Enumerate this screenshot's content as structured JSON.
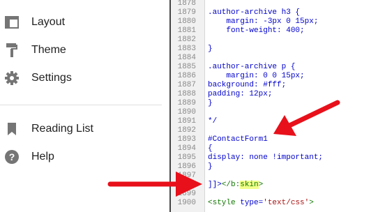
{
  "sidebar": {
    "items": [
      {
        "label": "Layout",
        "icon": "layout-icon"
      },
      {
        "label": "Theme",
        "icon": "paint-roller-icon"
      },
      {
        "label": "Settings",
        "icon": "gear-icon"
      },
      {
        "label": "Reading List",
        "icon": "bookmark-icon"
      },
      {
        "label": "Help",
        "icon": "help-icon"
      }
    ]
  },
  "editor": {
    "lines": [
      {
        "n": "1878",
        "t": ""
      },
      {
        "n": "1879",
        "t": ".author-archive h3 {"
      },
      {
        "n": "1880",
        "t": "    margin: -3px 0 15px;"
      },
      {
        "n": "1881",
        "t": "    font-weight: 400;"
      },
      {
        "n": "1882",
        "t": ""
      },
      {
        "n": "1883",
        "t": "}"
      },
      {
        "n": "1884",
        "t": ""
      },
      {
        "n": "1885",
        "t": ".author-archive p {"
      },
      {
        "n": "1886",
        "t": "    margin: 0 0 15px;"
      },
      {
        "n": "1887",
        "t": "background: #fff;"
      },
      {
        "n": "1888",
        "t": "padding: 12px;"
      },
      {
        "n": "1889",
        "t": "}"
      },
      {
        "n": "1890",
        "t": ""
      },
      {
        "n": "1891",
        "t": "*/"
      },
      {
        "n": "1892",
        "t": ""
      },
      {
        "n": "1893",
        "t": "#ContactForm1"
      },
      {
        "n": "1894",
        "t": "{"
      },
      {
        "n": "1895",
        "t": "display: none !important;"
      },
      {
        "n": "1896",
        "t": "}"
      },
      {
        "n": "1897",
        "t": ""
      },
      {
        "n": "1898",
        "t": "]]>",
        "close_tag_open": "</b:",
        "close_tag_name": "skin",
        "close_tag_end": ">"
      },
      {
        "n": "1899",
        "t": ""
      },
      {
        "n": "1900",
        "t": "",
        "style_open": "<style ",
        "style_attr": "type=",
        "style_val": "'text/css'",
        "style_end": ">"
      }
    ]
  },
  "colors": {
    "code_text": "#0000cc",
    "tag": "#117700",
    "highlight": "#f2ff8a",
    "arrow": "#e8101a"
  }
}
